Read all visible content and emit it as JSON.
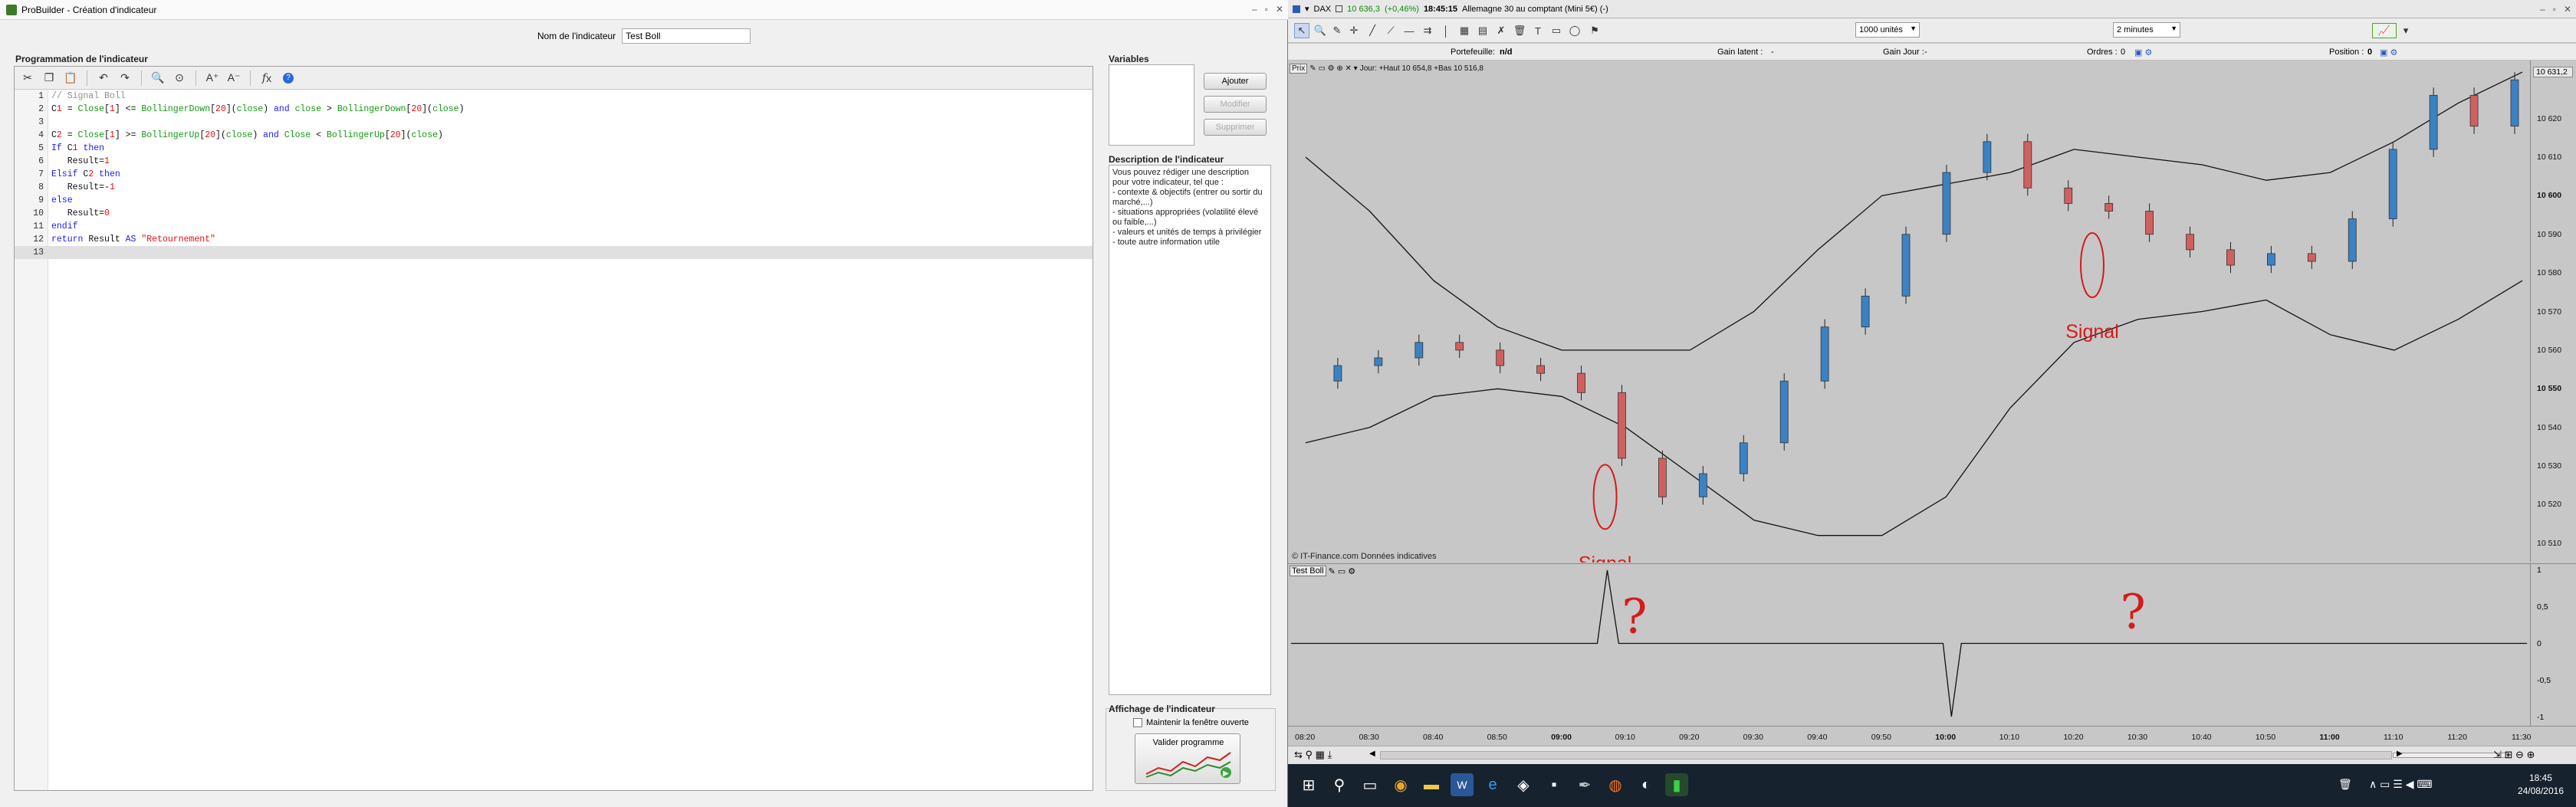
{
  "left_window": {
    "title": "ProBuilder - Création d'indicateur",
    "name_label": "Nom de l'indicateur",
    "name_value": "Test Boll",
    "section_title": "Programmation de l'indicateur",
    "variables_title": "Variables",
    "buttons": {
      "add": "Ajouter",
      "modify": "Modifier",
      "delete": "Supprimer"
    },
    "description_title": "Description de l'indicateur",
    "description_text": "Vous pouvez rédiger une description pour votre indicateur, tel que :\n- contexte & objectifs (entrer ou sortir du marché,...)\n- situations appropriées (volatilité élevé ou faible,...)\n- valeurs et unités de temps à privilégier\n- toute autre information utile",
    "display_title": "Affichage de l'indicateur",
    "keep_open_label": "Maintenir la fenêtre ouverte",
    "validate_label": "Valider programme",
    "code_lines": [
      {
        "n": "1",
        "t": "// Signal Boll"
      },
      {
        "n": "2",
        "t": "C1 = Close[1] <= BollingerDown[20](close) and close > BollingerDown[20](close)"
      },
      {
        "n": "3",
        "t": ""
      },
      {
        "n": "4",
        "t": "C2 = Close[1] >= BollingerUp[20](close) and Close < BollingerUp[20](close)"
      },
      {
        "n": "5",
        "t": "If C1 then"
      },
      {
        "n": "6",
        "t": "   Result=1"
      },
      {
        "n": "7",
        "t": "Elsif C2 then"
      },
      {
        "n": "8",
        "t": "   Result=-1"
      },
      {
        "n": "9",
        "t": "else"
      },
      {
        "n": "10",
        "t": "   Result=0"
      },
      {
        "n": "11",
        "t": "endif"
      },
      {
        "n": "12",
        "t": "return Result AS \"Retournement\""
      },
      {
        "n": "13",
        "t": ""
      }
    ]
  },
  "right_window": {
    "instrument": "DAX",
    "price": "10 636,3",
    "change": "(+0,46%)",
    "time": "18:45:15",
    "description": "Allemagne 30 au comptant (Mini 5€) (-)",
    "units_select": "1000 unités",
    "interval_select": "2 minutes",
    "portfolio_label": "Portefeuille:",
    "portfolio_value": "n/d",
    "latent_label": "Gain latent :",
    "latent_value": "-",
    "day_gain_label": "Gain Jour :",
    "day_gain_value": "-",
    "orders_label": "Ordres :",
    "orders_value": "0",
    "position_label": "Position :",
    "position_value": "0",
    "chart_header": "Jour: +Haut 10 654,8 +Bas 10 516,8",
    "chart_header_prefix": "Prix",
    "last_price_box": "10 631,2",
    "credit": "© IT-Finance.com Données indicatives",
    "sub_title": "Test Boll",
    "signal_label": "Signal",
    "question_mark": "?",
    "y_ticks": [
      "10 620",
      "10 610",
      "10 600",
      "10 590",
      "10 580",
      "10 570",
      "10 560",
      "10 550",
      "10 540",
      "10 530",
      "10 520",
      "10 510"
    ],
    "sub_ticks": [
      "1",
      "0,5",
      "0",
      "-0,5",
      "-1"
    ],
    "x_ticks": [
      "08:20",
      "08:30",
      "08:40",
      "08:50",
      "09:00",
      "09:10",
      "09:20",
      "09:30",
      "09:40",
      "09:50",
      "10:00",
      "10:10",
      "10:20",
      "10:30",
      "10:40",
      "10:50",
      "11:00",
      "11:10",
      "11:20",
      "11:30"
    ],
    "x_ticks_bold": [
      "09:00",
      "10:00",
      "11:00"
    ]
  },
  "taskbar": {
    "time": "18:45",
    "date": "24/08/2016"
  },
  "chart_data": {
    "type": "candlestick",
    "instrument": "DAX",
    "interval": "2 minutes",
    "ylim": [
      10505,
      10635
    ],
    "x": [
      "08:20",
      "08:30",
      "08:40",
      "08:50",
      "09:00",
      "09:10",
      "09:20",
      "09:30",
      "09:40",
      "09:50",
      "10:00",
      "10:10",
      "10:20",
      "10:30",
      "10:40",
      "10:50",
      "11:00",
      "11:10",
      "11:20",
      "11:30"
    ],
    "close": [
      10552,
      10556,
      10558,
      10562,
      10560,
      10556,
      10554,
      10549,
      10532,
      10522,
      10528,
      10536,
      10552,
      10566,
      10574,
      10590,
      10606,
      10614,
      10602,
      10598,
      10596,
      10590,
      10586,
      10582,
      10585,
      10583,
      10594,
      10612,
      10626,
      10618,
      10630
    ],
    "bollinger_up": [
      10610,
      10596,
      10578,
      10566,
      10560,
      10560,
      10560,
      10570,
      10586,
      10600,
      10603,
      10606,
      10612,
      10610,
      10608,
      10604,
      10606,
      10614,
      10624,
      10632
    ],
    "bollinger_down": [
      10536,
      10540,
      10548,
      10550,
      10548,
      10540,
      10528,
      10516,
      10512,
      10512,
      10522,
      10545,
      10562,
      10568,
      10570,
      10573,
      10564,
      10560,
      10568,
      10578
    ],
    "indicator": {
      "name": "Test Boll",
      "signals": [
        {
          "x": "09:07",
          "value": 1
        },
        {
          "x": "10:01",
          "value": -1
        }
      ]
    }
  }
}
